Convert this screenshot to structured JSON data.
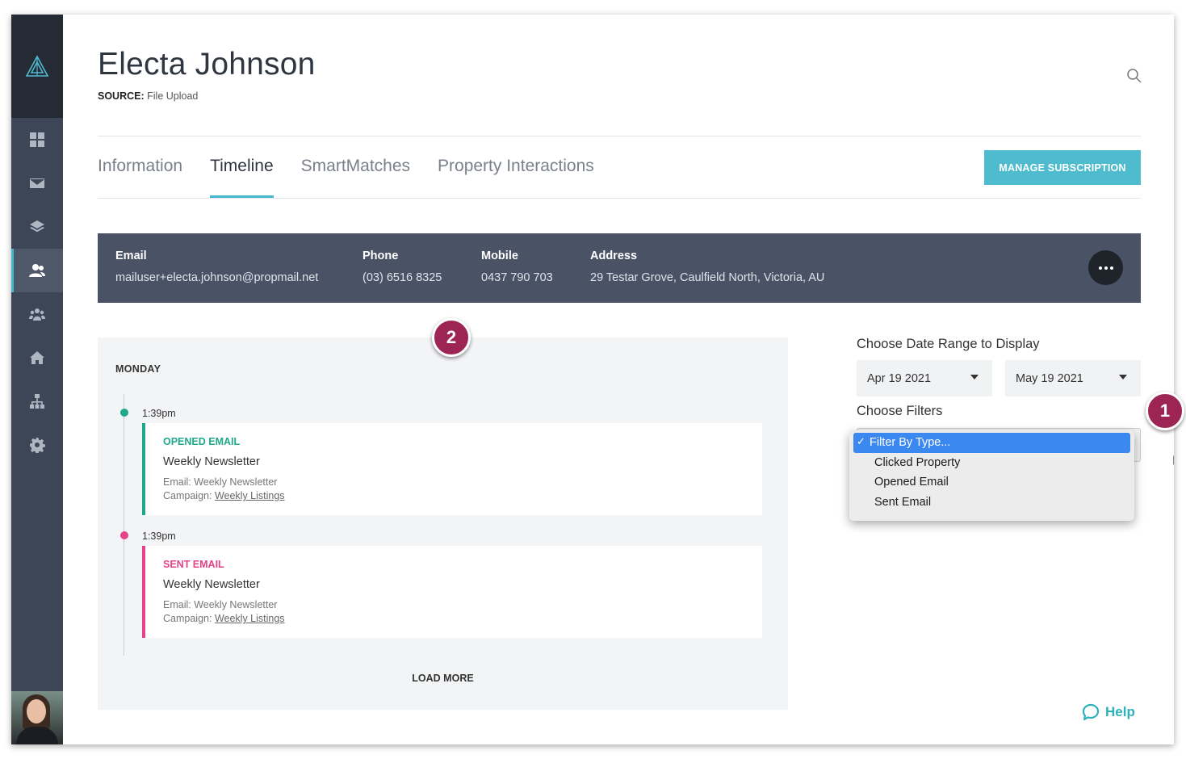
{
  "contact": {
    "name": "Electa Johnson",
    "source_label": "SOURCE:",
    "source_value": "File Upload"
  },
  "tabs": [
    {
      "label": "Information",
      "active": false
    },
    {
      "label": "Timeline",
      "active": true
    },
    {
      "label": "SmartMatches",
      "active": false
    },
    {
      "label": "Property Interactions",
      "active": false
    }
  ],
  "manage_button": "MANAGE SUBSCRIPTION",
  "details": {
    "email_label": "Email",
    "email_value": "mailuser+electa.johnson@propmail.net",
    "phone_label": "Phone",
    "phone_value": "(03) 6516 8325",
    "mobile_label": "Mobile",
    "mobile_value": "0437 790 703",
    "address_label": "Address",
    "address_value": "29 Testar Grove, Caulfield North, Victoria, AU"
  },
  "timeline": {
    "day": "MONDAY",
    "events": [
      {
        "time": "1:39pm",
        "type": "OPENED EMAIL",
        "color": "#1fa88b",
        "title": "Weekly Newsletter",
        "email_line": "Email: Weekly Newsletter",
        "campaign_label": "Campaign:",
        "campaign_link": "Weekly Listings"
      },
      {
        "time": "1:39pm",
        "type": "SENT EMAIL",
        "color": "#e6438a",
        "title": "Weekly Newsletter",
        "email_line": "Email: Weekly Newsletter",
        "campaign_label": "Campaign:",
        "campaign_link": "Weekly Listings"
      }
    ],
    "load_more": "LOAD MORE"
  },
  "filters": {
    "date_range_label": "Choose Date Range to Display",
    "date_from": "Apr 19 2021",
    "date_to": "May 19 2021",
    "filters_label": "Choose Filters",
    "options": [
      "Filter By Type...",
      "Clicked Property",
      "Opened Email",
      "Sent Email"
    ],
    "selected": "Filter By Type..."
  },
  "help": "Help",
  "callouts": [
    "1",
    "2"
  ],
  "colors": {
    "accent": "#45b8d0",
    "sidebar": "#3d4656",
    "callout": "#9c2556"
  }
}
